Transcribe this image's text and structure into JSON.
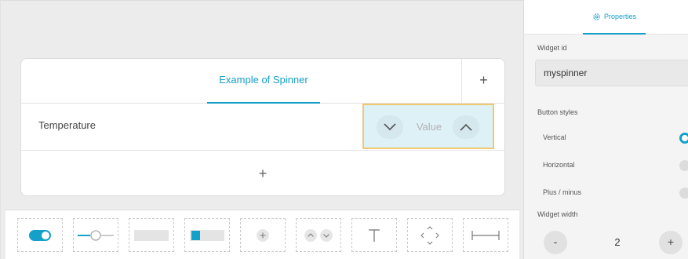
{
  "canvas": {
    "card": {
      "title": "Example of Spinner",
      "add_tab_symbol": "+",
      "row": {
        "label": "Temperature",
        "spinner": {
          "down_icon": "chevron-down-icon",
          "value_text": "Value",
          "up_icon": "chevron-up-icon"
        }
      },
      "add_row_symbol": "+"
    }
  },
  "toolbar": {
    "tools": [
      {
        "name": "toggle-widget",
        "icon": "toggle-icon"
      },
      {
        "name": "slider-widget",
        "icon": "slider-icon"
      },
      {
        "name": "button-widget",
        "icon": "button-icon"
      },
      {
        "name": "group-button-widget",
        "icon": "group-button-icon"
      },
      {
        "name": "icon-button-widget",
        "icon": "circle-plus-icon"
      },
      {
        "name": "spinner-widget",
        "icon": "spinner-icon"
      },
      {
        "name": "text-widget",
        "icon": "text-icon",
        "glyph": "T"
      },
      {
        "name": "directional-pad-widget",
        "icon": "directional-pad-icon"
      },
      {
        "name": "spacer-widget",
        "icon": "spacer-icon"
      }
    ]
  },
  "properties": {
    "tab_label": "Properties",
    "tab_icon": "gear-icon",
    "widget_id_label": "Widget id",
    "widget_id_value": "myspinner",
    "button_styles_label": "Button styles",
    "button_styles": [
      {
        "label": "Vertical",
        "selected": true
      },
      {
        "label": "Horizontal",
        "selected": false
      },
      {
        "label": "Plus / minus",
        "selected": false
      }
    ],
    "widget_width_label": "Widget width",
    "width_minus": "-",
    "width_value": "2",
    "width_plus": "+"
  },
  "colors": {
    "accent": "#15a0c9",
    "selection_outline": "#f0c870",
    "spinner_bg": "#def1f6"
  }
}
